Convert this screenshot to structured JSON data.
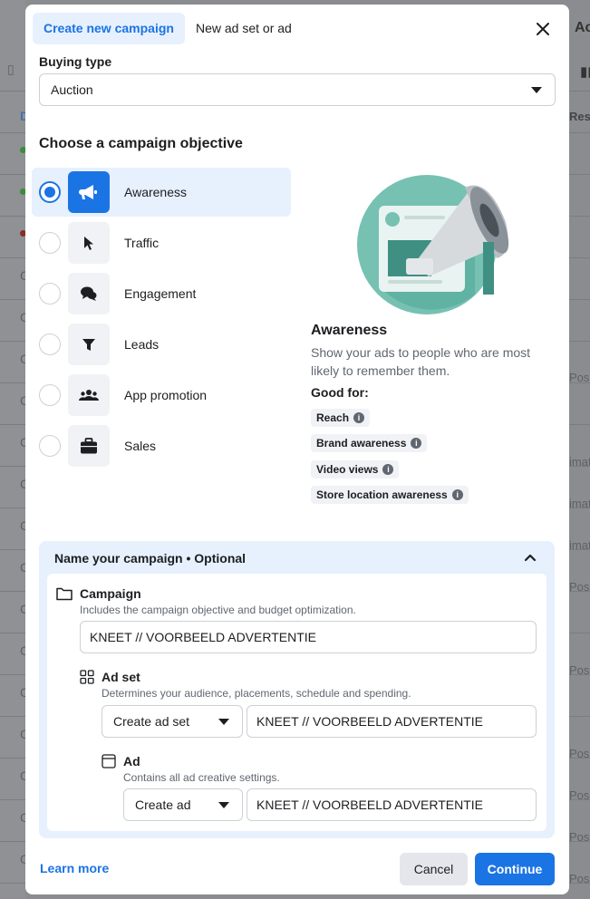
{
  "background": {
    "right_header": "Ac",
    "right_col_header": "Res",
    "left_col_header": "D",
    "right_cells": [
      "Pos",
      "imat",
      "imat",
      "imat",
      "Pos",
      "Pos",
      "Pos",
      "Pos",
      "Pos",
      "Pos"
    ],
    "left_cells": [
      "C",
      "C",
      "C",
      "C",
      "C",
      "C",
      "C",
      "C",
      "C",
      "C",
      "C",
      "C",
      "C",
      "C",
      "C",
      "C"
    ]
  },
  "tabs": {
    "create_campaign": "Create new campaign",
    "new_adset_or_ad": "New ad set or ad"
  },
  "buying_type": {
    "label": "Buying type",
    "value": "Auction"
  },
  "objective": {
    "title": "Choose a campaign objective",
    "options": [
      {
        "label": "Awareness",
        "icon": "megaphone-icon",
        "selected": true
      },
      {
        "label": "Traffic",
        "icon": "cursor-icon",
        "selected": false
      },
      {
        "label": "Engagement",
        "icon": "chat-bubbles-icon",
        "selected": false
      },
      {
        "label": "Leads",
        "icon": "funnel-icon",
        "selected": false
      },
      {
        "label": "App promotion",
        "icon": "people-icon",
        "selected": false
      },
      {
        "label": "Sales",
        "icon": "briefcase-icon",
        "selected": false
      }
    ]
  },
  "description": {
    "title": "Awareness",
    "text": "Show your ads to people who are most likely to remember them.",
    "good_for_label": "Good for:",
    "good_for": [
      "Reach",
      "Brand awareness",
      "Video views",
      "Store location awareness"
    ]
  },
  "naming": {
    "header": "Name your campaign • Optional",
    "campaign": {
      "title": "Campaign",
      "subtitle": "Includes the campaign objective and budget optimization.",
      "value": "KNEET // VOORBEELD ADVERTENTIE"
    },
    "adset": {
      "title": "Ad set",
      "subtitle": "Determines your audience, placements, schedule and spending.",
      "select": "Create ad set",
      "value": "KNEET // VOORBEELD ADVERTENTIE"
    },
    "ad": {
      "title": "Ad",
      "subtitle": "Contains all ad creative settings.",
      "select": "Create ad",
      "value": "KNEET // VOORBEELD ADVERTENTIE"
    }
  },
  "footer": {
    "learn_more": "Learn more",
    "cancel": "Cancel",
    "continue": "Continue"
  },
  "colors": {
    "accent": "#1b74e4",
    "selected_bg": "#e7f0fd",
    "illustration_teal": "#76c1b2"
  }
}
